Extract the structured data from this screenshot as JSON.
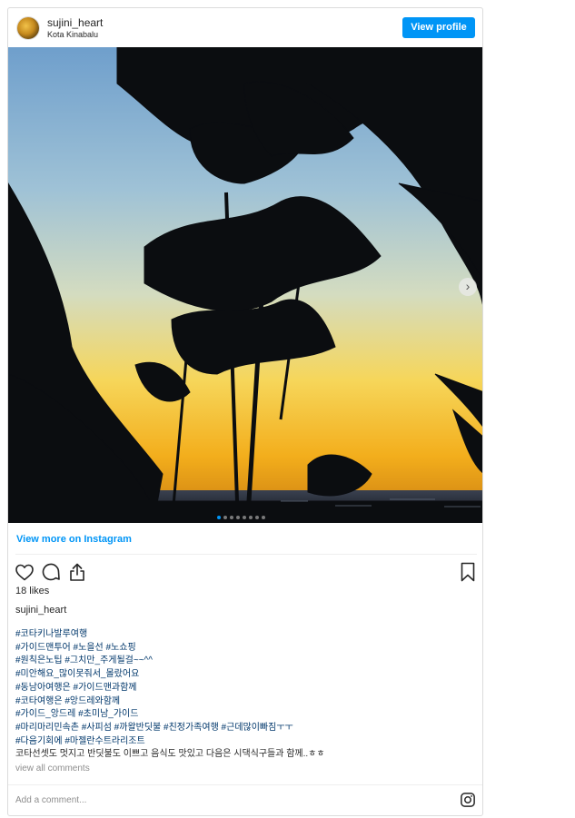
{
  "header": {
    "username": "sujini_heart",
    "location": "Kota Kinabalu",
    "view_profile_label": "View profile"
  },
  "photo": {
    "carousel_count": 8,
    "carousel_active": 1,
    "next_icon": "chevron-right-icon"
  },
  "links": {
    "view_more": "View more on Instagram"
  },
  "actions": {
    "icons": [
      "heart-icon",
      "comment-icon",
      "share-icon",
      "bookmark-icon"
    ]
  },
  "post": {
    "likes": "18 likes",
    "owner": "sujini_heart",
    "caption_lines": [
      "#코타키나발루여행",
      "#가이드맨투어 #노을선 #노쇼핑",
      "#원칙은노팁 #그치만_주게될걸~~^^",
      "#미안해요_많이못줘서_몰랐어요",
      "#동남아여행은 #가이드맨과함께",
      "#코타여행은 #앙드레와함께",
      "#가이드_앙드레 #초미남_가이드",
      "#마리마리민속촌 #사피섬 #까왈반딧불 #친정가족여행 #근데많이빠짐ㅜㅜ",
      "#다음기회에 #마젤란수트라리조트",
      "코타선셋도 멋지고 반딧불도 이쁘고 음식도 맛있고 다음은 시댁식구들과 함께..ㅎㅎ"
    ],
    "view_all_comments": "view all comments",
    "add_comment_placeholder": "Add a comment..."
  },
  "colors": {
    "accent": "#0095f6",
    "text": "#262626",
    "hashtag": "#00376b",
    "muted": "#8e8e8e"
  }
}
